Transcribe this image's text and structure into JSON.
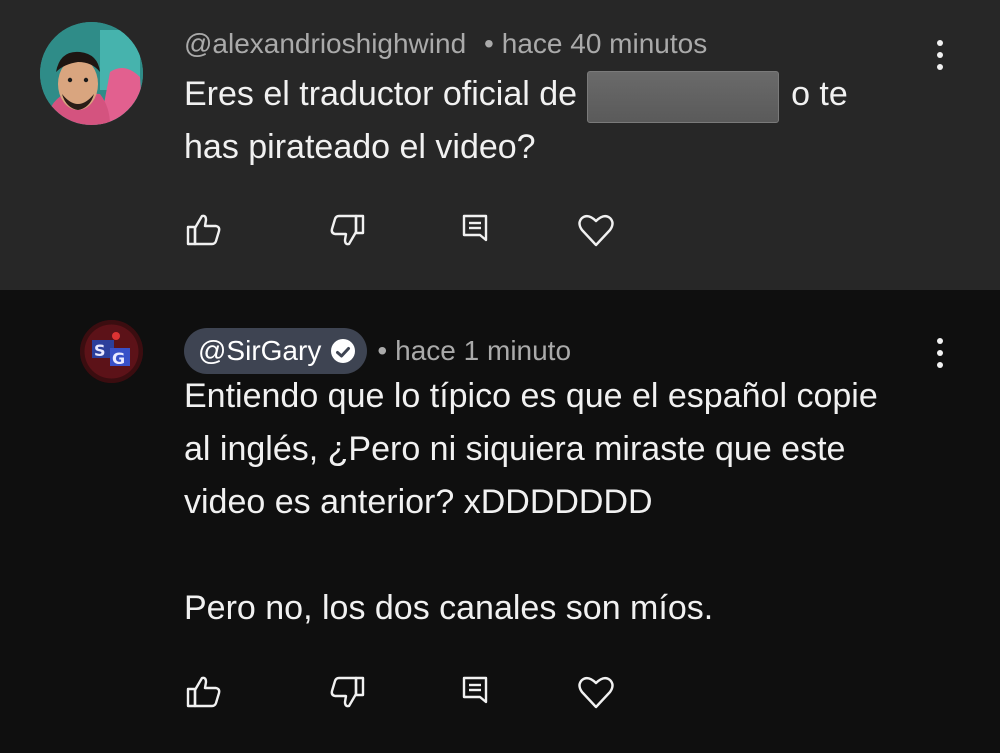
{
  "comments": [
    {
      "author": "@alexandrioshighwind",
      "separator": "•",
      "timestamp": "hace 40 minutos",
      "text_before_redaction": "Eres el traductor oficial de",
      "text_after_redaction": "o te",
      "text_line2": "has pirateado el video?",
      "avatar_icon": "user-photo-avatar",
      "actions": [
        "thumb-up-icon",
        "thumb-down-icon",
        "reply-icon",
        "heart-icon"
      ]
    },
    {
      "author": "@SirGary",
      "verified": true,
      "separator": "•",
      "timestamp": "hace 1 minuto",
      "lines": [
        "Entiendo que lo típico es que el español copie",
        "al inglés, ¿Pero ni siquiera miraste que este",
        "video es anterior? xDDDDDDD",
        "",
        "Pero no, los dos canales son míos."
      ],
      "avatar_icon": "sg-logo-avatar",
      "actions": [
        "thumb-up-icon",
        "thumb-down-icon",
        "reply-icon",
        "heart-icon"
      ]
    }
  ],
  "colors": {
    "first_comment_bg": "#272727",
    "second_comment_bg": "#0f0f0f",
    "author_pill_bg": "#3e4452",
    "meta_text": "#aaaaaa",
    "body_text": "#f1f1f1"
  }
}
